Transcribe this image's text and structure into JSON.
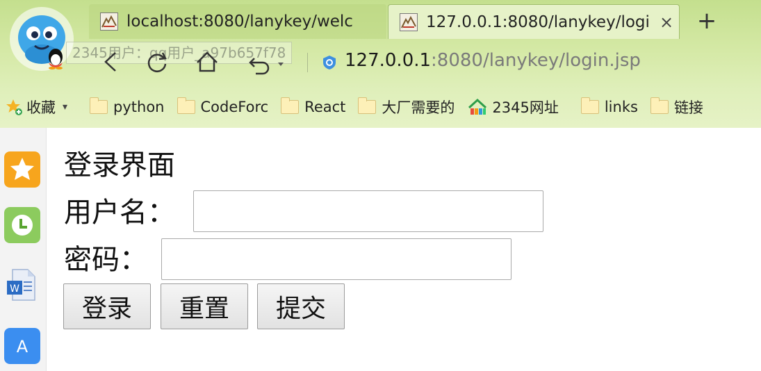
{
  "browser": {
    "tabs": [
      {
        "title": "localhost:8080/lanykey/welc",
        "active": false
      },
      {
        "title": "127.0.0.1:8080/lanykey/logi",
        "active": true,
        "close_label": "×"
      }
    ],
    "new_tab_label": "+",
    "tooltip": "2345用户：qq用户_a97b657f78",
    "url_host": "127.0.0.1",
    "url_rest": ":8080/lanykey/login.jsp",
    "bookmarks": [
      {
        "label": "收藏",
        "icon": "star-plus-icon",
        "dropdown": "▾"
      },
      {
        "label": "python",
        "icon": "folder-icon"
      },
      {
        "label": "CodeForc",
        "icon": "folder-icon"
      },
      {
        "label": "React",
        "icon": "folder-icon"
      },
      {
        "label": "大厂需要的",
        "icon": "folder-icon"
      },
      {
        "label": "2345网址",
        "icon": "2345-logo-icon"
      },
      {
        "label": "links",
        "icon": "folder-icon"
      },
      {
        "label": "链接",
        "icon": "folder-icon"
      }
    ],
    "accent_color": "#c4df8e"
  },
  "sidebar": {
    "icons": [
      "favorites-star-icon",
      "history-clock-icon",
      "word-document-icon",
      "app-store-icon"
    ]
  },
  "page": {
    "title": "登录界面",
    "username_label": "用户名：",
    "username_value": "",
    "password_label": "密码：",
    "password_value": "",
    "buttons": {
      "login": "登录",
      "reset": "重置",
      "submit": "提交"
    }
  }
}
